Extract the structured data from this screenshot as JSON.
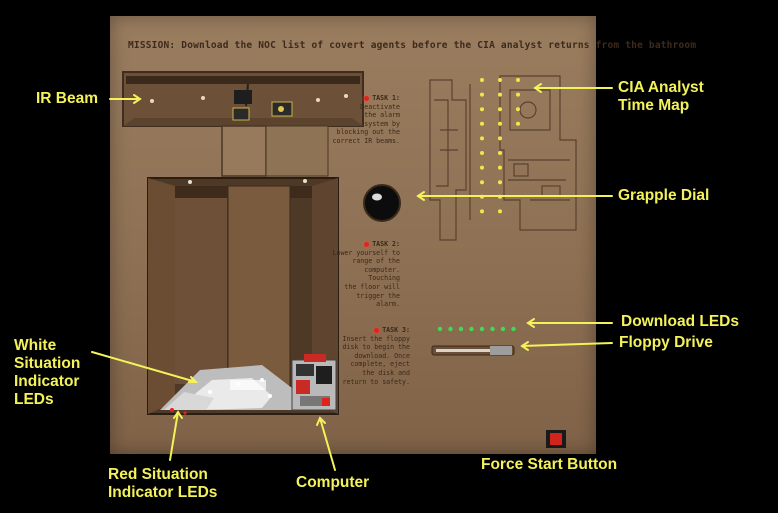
{
  "mission_text": "MISSION: Download the NOC list of covert agents before the CIA analyst returns from the bathroom",
  "tasks": [
    {
      "id": "1",
      "heading": "TASK 1:",
      "body": [
        "Deactivate",
        "the alarm",
        "system by",
        "blocking out the",
        "correct IR beams."
      ]
    },
    {
      "id": "2",
      "heading": "TASK 2:",
      "body": [
        "Lower yourself to",
        "range of the",
        "computer. Touching",
        "the floor will",
        "trigger the alarm."
      ]
    },
    {
      "id": "3",
      "heading": "TASK 3:",
      "body": [
        "Insert the floppy",
        "disk to begin the",
        "download. Once",
        "complete, eject",
        "the disk and",
        "return to safety."
      ]
    }
  ],
  "callouts": {
    "ir_beam": "IR Beam",
    "cia_analyst_time_map_line1": "CIA Analyst",
    "cia_analyst_time_map_line2": "Time Map",
    "grapple_dial": "Grapple Dial",
    "download_leds": "Download LEDs",
    "floppy_drive": "Floppy Drive",
    "white_leds_line1": "White",
    "white_leds_line2": "Situation",
    "white_leds_line3": "Indicator",
    "white_leds_line4": "LEDs",
    "red_leds_line1": "Red Situation",
    "red_leds_line2": "Indicator LEDs",
    "computer": "Computer",
    "force_start_button": "Force Start Button"
  },
  "colors": {
    "callout_text": "#f4f25a",
    "arrow": "#f4f25a",
    "board": "#8e7154",
    "background": "#000000",
    "led_green": "#3ddc54",
    "led_red": "#e0241d",
    "led_yellow": "#f2e64a"
  },
  "download_leds_count": 8,
  "time_map_leds_count": 28
}
